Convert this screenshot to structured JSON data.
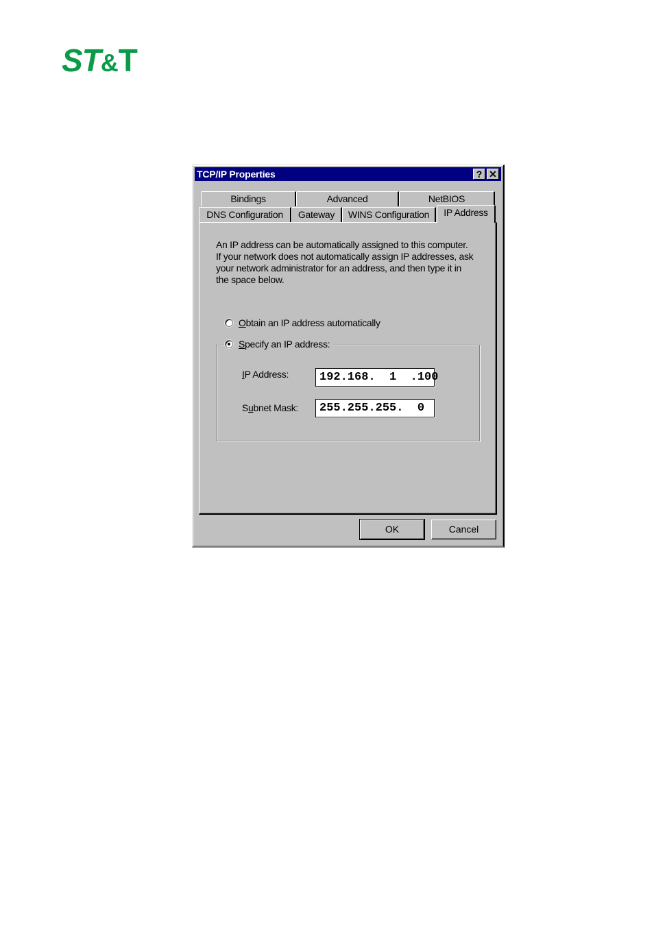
{
  "brand": {
    "logo_prefix": "ST",
    "logo_amp": "&",
    "logo_suffix": "T",
    "color": "#0a9a48"
  },
  "dialog": {
    "title": "TCP/IP Properties",
    "help_button": "?",
    "close_button": "✕",
    "tabs_row_back": [
      {
        "label": "Bindings"
      },
      {
        "label": "Advanced"
      },
      {
        "label": "NetBIOS"
      }
    ],
    "tabs_row_front": [
      {
        "label": "DNS Configuration"
      },
      {
        "label": "Gateway"
      },
      {
        "label": "WINS Configuration"
      },
      {
        "label": "IP Address",
        "active": true
      }
    ],
    "description_lines": [
      "An IP address can be automatically assigned to this computer.",
      "If your network does not automatically assign IP addresses, ask",
      "your network administrator for an address, and then type it in",
      "the space below."
    ],
    "radio_obtain": {
      "accel": "O",
      "rest": "btain an IP address automatically",
      "checked": false
    },
    "radio_specify": {
      "accel": "S",
      "rest": "pecify an IP address:",
      "checked": true
    },
    "ip_address": {
      "label_accel": "I",
      "label_rest": "P Address:",
      "value": "192.168.  1  .100"
    },
    "subnet_mask": {
      "label_pre": "S",
      "label_accel": "u",
      "label_rest": "bnet Mask:",
      "value": "255.255.255.  0"
    },
    "ok_label": "OK",
    "cancel_label": "Cancel"
  }
}
